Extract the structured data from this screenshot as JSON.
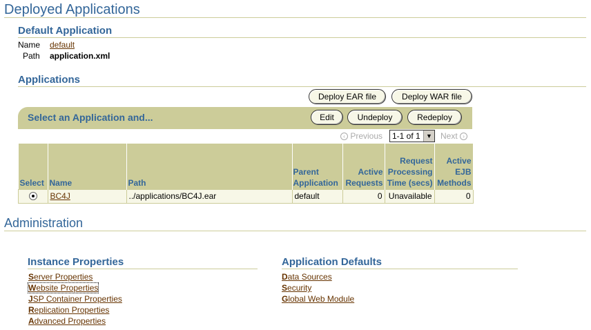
{
  "header": {
    "title": "Deployed Applications"
  },
  "default_app": {
    "heading": "Default Application",
    "name_label": "Name",
    "name_value": "default",
    "path_label": "Path",
    "path_value": "application.xml"
  },
  "applications": {
    "heading": "Applications",
    "deploy_ear_label": "Deploy EAR file",
    "deploy_war_label": "Deploy WAR file",
    "bar_title": "Select an Application and...",
    "edit_label": "Edit",
    "undeploy_label": "Undeploy",
    "redeploy_label": "Redeploy",
    "previous_label": "Previous",
    "range_value": "1-1 of 1",
    "next_label": "Next",
    "columns": [
      "Select",
      "Name",
      "Path",
      "Parent Application",
      "Active Requests",
      "Request Processing Time (secs)",
      "Active EJB Methods"
    ],
    "rows": [
      {
        "name": "BC4J",
        "path": "../applications/BC4J.ear",
        "parent": "default",
        "active_requests": "0",
        "processing_time": "Unavailable",
        "ejb_methods": "0"
      }
    ]
  },
  "admin": {
    "title": "Administration",
    "instance": {
      "heading": "Instance Properties",
      "links": [
        {
          "key": "S",
          "rest": "erver Properties"
        },
        {
          "key": "W",
          "rest": "ebsite Properties"
        },
        {
          "key": "J",
          "rest": "SP Container Properties"
        },
        {
          "key": "R",
          "rest": "eplication Properties"
        },
        {
          "key": "A",
          "rest": "dvanced Properties"
        }
      ]
    },
    "defaults": {
      "heading": "Application Defaults",
      "links": [
        {
          "key": "D",
          "rest": "ata Sources"
        },
        {
          "key": "S",
          "rest": "ecurity"
        },
        {
          "key": "G",
          "rest": "lobal Web Module"
        }
      ]
    }
  }
}
